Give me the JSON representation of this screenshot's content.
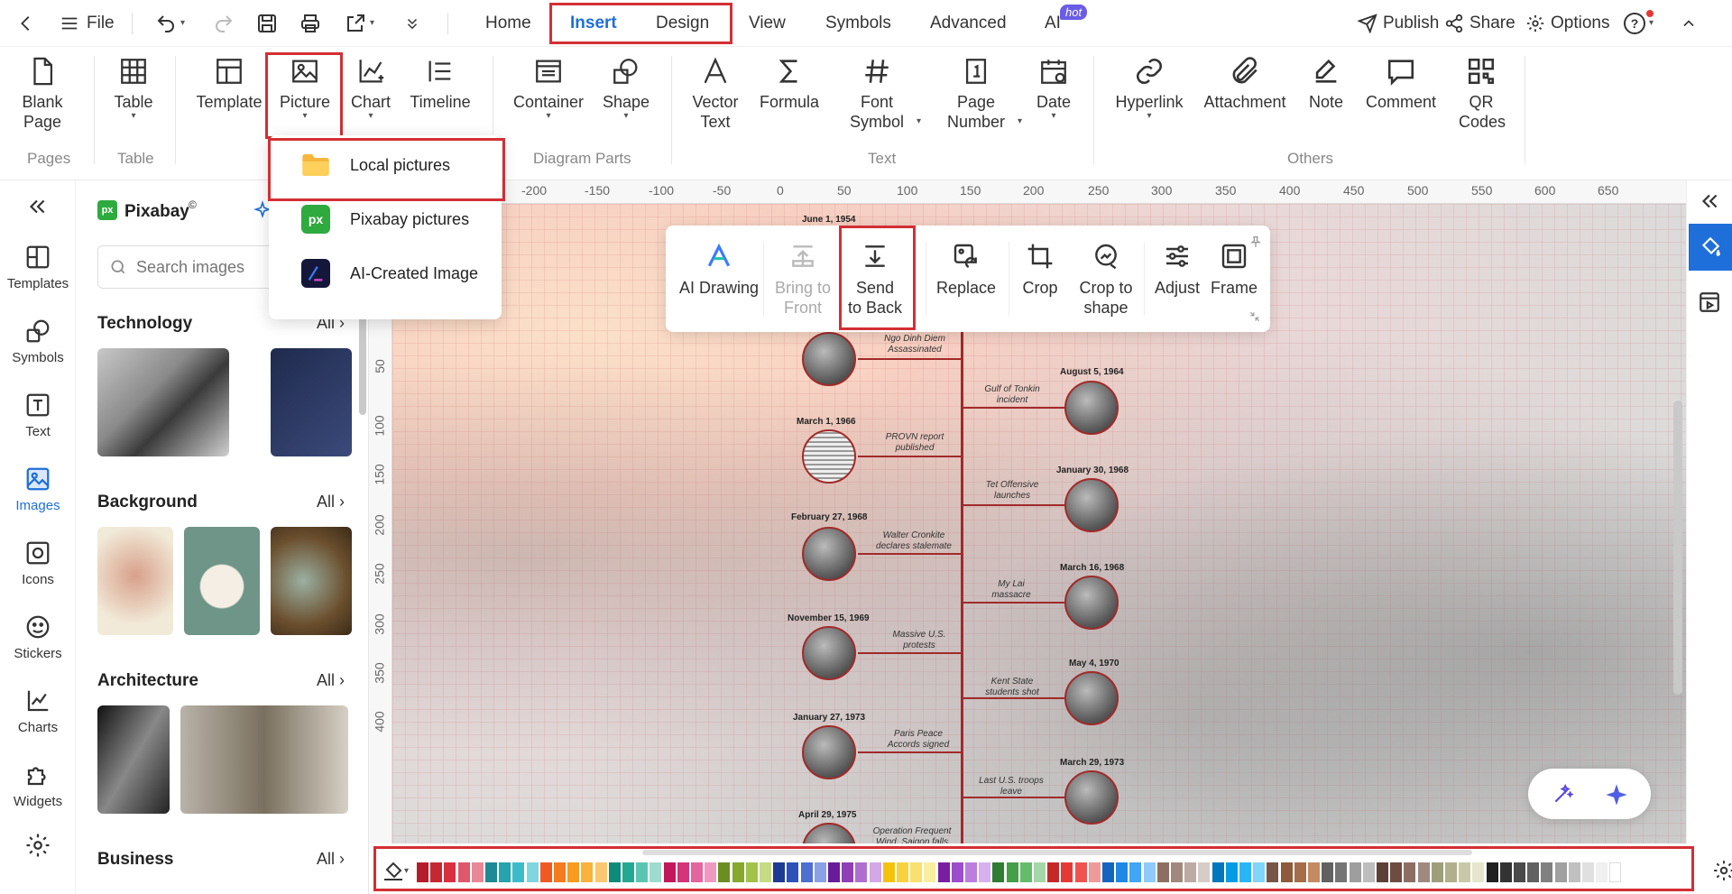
{
  "menubar": {
    "file": "File",
    "tabs": [
      "Home",
      "Insert",
      "Design",
      "View",
      "Symbols",
      "Advanced",
      "AI"
    ],
    "ai_badge": "hot",
    "publish": "Publish",
    "share": "Share",
    "options": "Options",
    "help": "?"
  },
  "ribbon": {
    "items": {
      "blank_page": "Blank Page",
      "table": "Table",
      "template": "Template",
      "picture": "Picture",
      "chart": "Chart",
      "timeline": "Timeline",
      "container": "Container",
      "shape": "Shape",
      "vector_text": "Vector Text",
      "formula": "Formula",
      "font_symbol": "Font Symbol",
      "page_number": "Page Number",
      "date": "Date",
      "hyperlink": "Hyperlink",
      "attachment": "Attachment",
      "note": "Note",
      "comment": "Comment",
      "qr_codes": "QR Codes"
    },
    "groups": {
      "pages": "Pages",
      "table": "Table",
      "diagram_parts": "Diagram Parts",
      "text": "Text",
      "others": "Others"
    }
  },
  "picture_menu": [
    "Local pictures",
    "Pixabay pictures",
    "AI-Created Image"
  ],
  "rail": [
    "Templates",
    "Symbols",
    "Text",
    "Images",
    "Icons",
    "Stickers",
    "Charts",
    "Widgets"
  ],
  "library": {
    "brand": "Pixabay",
    "brand_mark": "©",
    "search_placeholder": "Search images",
    "sections": [
      "Technology",
      "Background",
      "Architecture",
      "Business"
    ],
    "all_label": "All"
  },
  "image_toolbar": {
    "ai_drawing": "AI Drawing",
    "bring_to_front": "Bring to Front",
    "send_to_back": "Send to Back",
    "replace": "Replace",
    "crop": "Crop",
    "crop_to_shape": "Crop to shape",
    "adjust": "Adjust",
    "frame": "Frame"
  },
  "ruler": {
    "top": [
      "-200",
      "-150",
      "-100",
      "-50",
      "0",
      "50",
      "100",
      "150",
      "200",
      "250",
      "300",
      "350",
      "400",
      "450",
      "500",
      "550",
      "600",
      "650"
    ],
    "left": [
      "50",
      "100",
      "150",
      "200",
      "250",
      "300",
      "350",
      "400"
    ]
  },
  "timeline": {
    "left": [
      {
        "date": "June 1, 1954",
        "caption": ""
      },
      {
        "date": "",
        "caption": "Ngo Dinh Diem Assassinated"
      },
      {
        "date": "March 1, 1966",
        "caption": "PROVN report published"
      },
      {
        "date": "February 27, 1968",
        "caption": "Walter Cronkite declares stalemate"
      },
      {
        "date": "November 15, 1969",
        "caption": "Massive U.S. protests"
      },
      {
        "date": "January 27, 1973",
        "caption": "Paris Peace Accords signed"
      },
      {
        "date": "April 29, 1975",
        "caption": "Operation Frequent Wind, Saigon falls"
      }
    ],
    "right": [
      {
        "date": "August 5, 1964",
        "caption": "Gulf of Tonkin incident"
      },
      {
        "date": "January 30, 1968",
        "caption": "Tet Offensive launches"
      },
      {
        "date": "March 16, 1968",
        "caption": "My Lai massacre"
      },
      {
        "date": "May 4, 1970",
        "caption": "Kent State students shot"
      },
      {
        "date": "March 29, 1973",
        "caption": "Last U.S. troops leave"
      }
    ]
  },
  "colors": {
    "accent": "#1e6fd9",
    "highlight": "#d32f35",
    "timeline": "#a12a2a",
    "palette": [
      "#b71c2b",
      "#c62832",
      "#d9303f",
      "#e0566a",
      "#e88796",
      "#1e8a93",
      "#26a3ad",
      "#3cbccb",
      "#7fd6df",
      "#f05a22",
      "#f47b20",
      "#f79a1e",
      "#f9b23b",
      "#fbc770",
      "#0e8c7b",
      "#23a892",
      "#5ac6b2",
      "#9fdcd0",
      "#c2185b",
      "#d6337a",
      "#e5649d",
      "#f099c0",
      "#6b8e23",
      "#84a92c",
      "#a3c24a",
      "#c5db84",
      "#1f3a93",
      "#2d52b8",
      "#4c6fd1",
      "#8aa2e3",
      "#6a1b9a",
      "#8e3fb5",
      "#b06fd0",
      "#d3a8e6",
      "#f4c20d",
      "#f7d23e",
      "#f9e06f",
      "#fbed9f",
      "#7b1fa2",
      "#9c4dcc",
      "#ba7de0",
      "#d7b0ef",
      "#2e7d32",
      "#43a047",
      "#66bb6a",
      "#a5d6a7",
      "#c62828",
      "#e53935",
      "#ef5350",
      "#ef9a9a",
      "#1565c0",
      "#1e88e5",
      "#42a5f5",
      "#90caf9",
      "#8d6e63",
      "#a1887f",
      "#bcaaa4",
      "#d7ccc8",
      "#0277bd",
      "#039be5",
      "#29b6f6",
      "#81d4fa",
      "#795548",
      "#8d5a3b",
      "#a56d4a",
      "#c48a63",
      "#616161",
      "#757575",
      "#9e9e9e",
      "#bdbdbd",
      "#5d4037",
      "#6d4c41",
      "#8d6e63",
      "#a1887f",
      "#9e9e7a",
      "#b0b08c",
      "#c9c9a8",
      "#e6e6cc",
      "#212121",
      "#333333",
      "#4a4a4a",
      "#616161",
      "#808080",
      "#a0a0a0",
      "#c0c0c0",
      "#e0e0e0",
      "#f0f0f0",
      "#ffffff"
    ]
  }
}
